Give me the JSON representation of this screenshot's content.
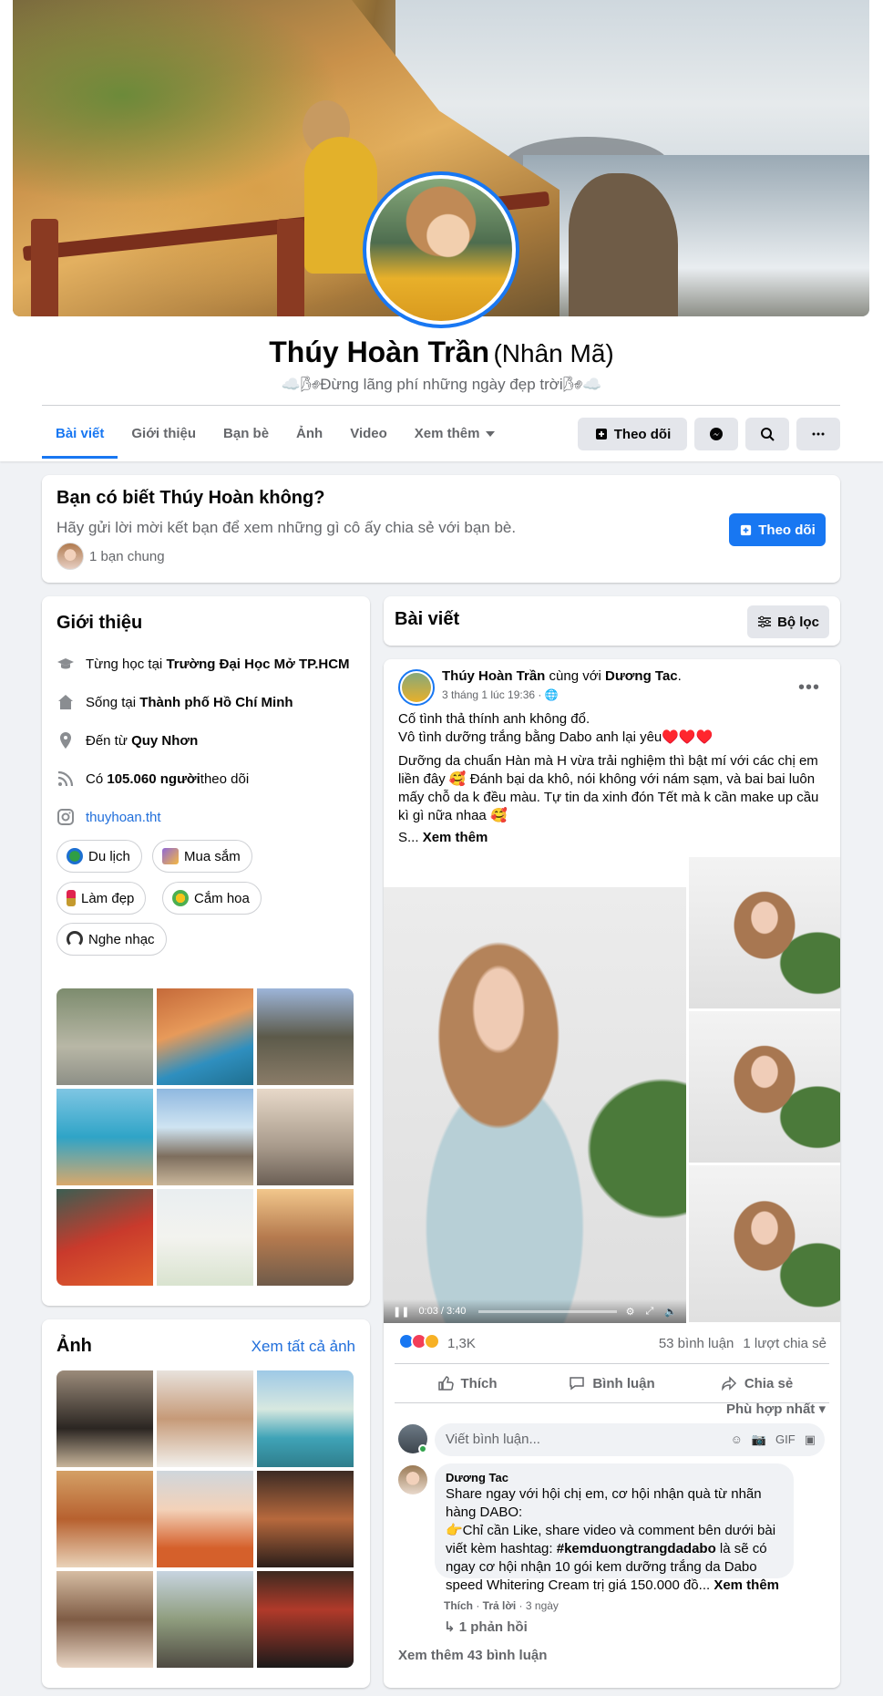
{
  "profile": {
    "name": "Thúy Hoàn Trần",
    "alt_name": "(Nhân Mã)",
    "bio": "☁️🌬Đừng lãng phí những ngày đẹp trời🌬☁️"
  },
  "tabs": [
    {
      "label": "Bài viết",
      "active": true
    },
    {
      "label": "Giới thiệu"
    },
    {
      "label": "Bạn bè"
    },
    {
      "label": "Ảnh"
    },
    {
      "label": "Video"
    },
    {
      "label": "Xem thêm"
    }
  ],
  "header_actions": {
    "follow_label": "Theo dõi",
    "messenger_icon": "messenger-icon",
    "search_icon": "search-icon",
    "more_icon": "more-icon"
  },
  "know_card": {
    "title": "Bạn có biết Thúy Hoàn không?",
    "subtitle": "Hãy gửi lời mời kết bạn để xem những gì cô ấy chia sẻ với bạn bè.",
    "mutual": "1 bạn chung",
    "follow_label": "Theo dõi"
  },
  "intro": {
    "title": "Giới thiệu",
    "studied_prefix": "Từng học tại ",
    "studied_place": "Trường Đại Học Mở TP.HCM",
    "lives_prefix": "Sống tại ",
    "lives_place": "Thành phố Hồ Chí Minh",
    "from_prefix": "Đến từ ",
    "from_place": "Quy Nhơn",
    "followers_prefix": "Có ",
    "followers_count": "105.060 người",
    "followers_suffix": " theo dõi",
    "instagram": "thuyhoan.tht",
    "hobbies": [
      "Du lịch",
      "Mua sắm",
      "Làm đẹp",
      "Cắm hoa",
      "Nghe nhạc"
    ]
  },
  "photos": {
    "title": "Ảnh",
    "see_all": "Xem tất cả ảnh"
  },
  "posts_header": {
    "title": "Bài viết",
    "filter_label": "Bộ lọc"
  },
  "post": {
    "author": "Thúy Hoàn Trần",
    "with_text": " cùng với ",
    "tagged": "Dương Tac",
    "time": "3 tháng 1 lúc 19:36 · ",
    "line1": "Cố tình thả thính anh không đổ.",
    "line2": "Vô tình dưỡng trắng bằng Dabo anh lại yêu♥️♥️♥️",
    "paragraph": "Dưỡng da chuẩn Hàn mà H vừa trải nghiệm thì bật mí với các chị em liền đây 🥰 Đánh bại da khô, nói không với nám sạm, và bai bai luôn mấy chỗ da k đều màu. Tự tin da xinh đón Tết mà k cần make up cầu kì gì nữa nhaa 🥰",
    "truncated": "S... ",
    "see_more": "Xem thêm",
    "video_time": "0:03 / 3:40",
    "reactions": "1,3K",
    "comments_count": "53 bình luận",
    "shares_count": "1 lượt chia sẻ",
    "like_label": "Thích",
    "comment_label": "Bình luận",
    "share_label": "Chia sẻ",
    "sort_label": "Phù hợp nhất",
    "comment_placeholder": "Viết bình luận..."
  },
  "comment": {
    "author": "Dương Tac",
    "line1": "Share ngay với hội chị em, cơ hội nhận quà từ nhãn hàng DABO:",
    "line2_pre": "👉Chỉ cần Like, share video và comment bên dưới bài viết kèm hashtag: ",
    "hashtag": "#kemduongtrangdadabo",
    "line2_post": " là sẽ có ngay cơ hội nhận 10 gói kem dưỡng trắng da Dabo speed Whitering Cream trị giá 150.000 đồ... ",
    "see_more": "Xem thêm",
    "like": "Thích",
    "reply": "Trả lời",
    "age": "3 ngày",
    "replies": "1 phản hồi",
    "view_more_comments": "Xem thêm 43 bình luận"
  }
}
